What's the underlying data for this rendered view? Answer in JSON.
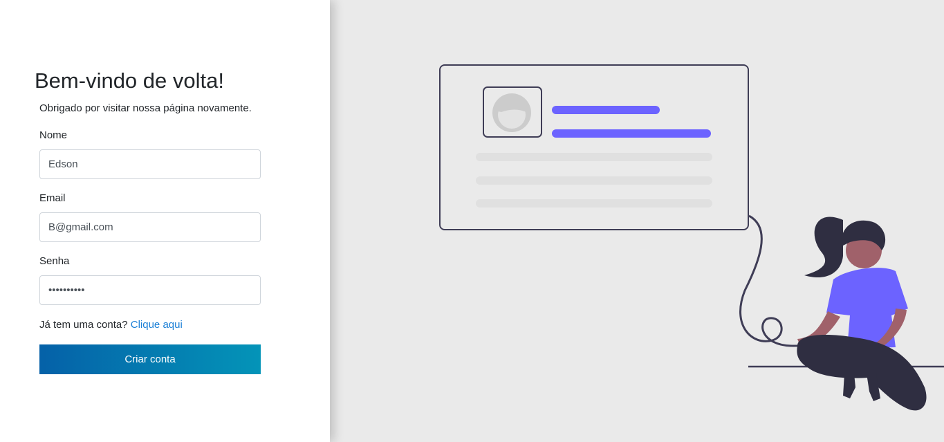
{
  "form": {
    "heading": "Bem-vindo de volta!",
    "subtitle": "Obrigado por visitar nossa página novamente.",
    "name_label": "Nome",
    "name_value": "Edson",
    "email_label": "Email",
    "email_value": "B@gmail.com",
    "password_label": "Senha",
    "password_value": "••••••••••",
    "signin_prompt": "Já tem uma conta?",
    "signin_link": "Clique aqui",
    "submit_label": "Criar conta"
  },
  "colors": {
    "button_gradient_start": "#0561a8",
    "button_gradient_end": "#0494b8",
    "link": "#1a7fd6",
    "illustration_accent": "#6c63ff",
    "illustration_dark": "#3f3d56",
    "illustration_skin": "#a0616a",
    "background": "#eaeaea"
  }
}
